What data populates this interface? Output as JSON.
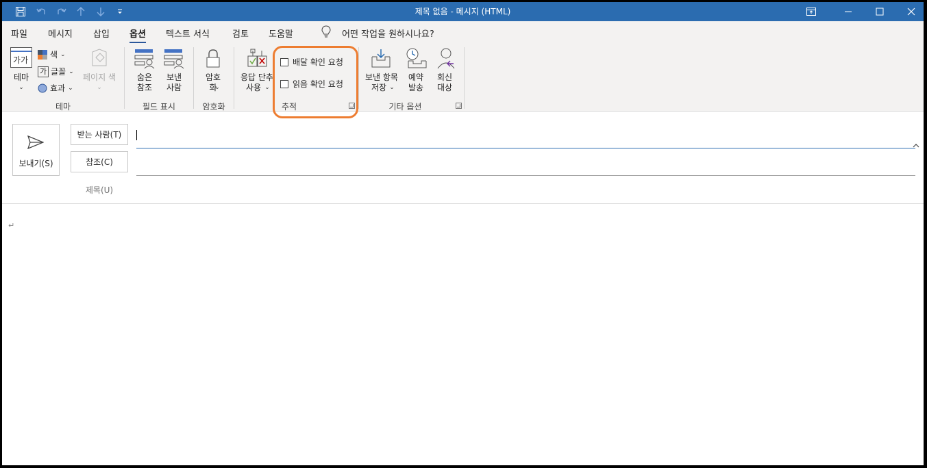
{
  "window": {
    "title": "제목 없음  -  메시지 (HTML)"
  },
  "quick_access": [
    "save-icon",
    "undo-icon",
    "redo-icon",
    "up-arrow-icon",
    "down-arrow-icon",
    "customize-icon"
  ],
  "menu": {
    "tabs": [
      {
        "label": "파일",
        "active": false
      },
      {
        "label": "메시지",
        "active": false
      },
      {
        "label": "삽입",
        "active": false
      },
      {
        "label": "옵션",
        "active": true
      },
      {
        "label": "텍스트 서식",
        "active": false
      },
      {
        "label": "검토",
        "active": false
      },
      {
        "label": "도움말",
        "active": false
      }
    ],
    "tell_me": "어떤 작업을 원하시나요?"
  },
  "ribbon": {
    "theme_group": {
      "label": "테마",
      "theme_button": "테마",
      "theme_icon_text": "가가",
      "colors": "색",
      "fonts": "글꼴",
      "fonts_icon_text": "가",
      "effects": "효과",
      "page_color": "페이지 색"
    },
    "fields_group": {
      "label": "필드 표시",
      "bcc_line1": "숨은",
      "bcc_line2": "참조",
      "from_line1": "보낸",
      "from_line2": "사람"
    },
    "encrypt_group": {
      "label": "암호화",
      "encrypt_line1": "암호",
      "encrypt_line2": "화"
    },
    "tracking_group": {
      "label": "추적",
      "voting_line1": "응답 단추",
      "voting_line2": "사용",
      "delivery_receipt": "배달 확인 요청",
      "read_receipt": "읽음 확인 요청"
    },
    "more_options_group": {
      "label": "기타 옵션",
      "save_sent_line1": "보낸 항목",
      "save_sent_line2": "저장",
      "delay_line1": "예약",
      "delay_line2": "발송",
      "reply_line1": "회신",
      "reply_line2": "대상"
    }
  },
  "compose": {
    "send": "보내기(S)",
    "to": "받는 사람(T)",
    "cc": "참조(C)",
    "subject": "제목(U)",
    "to_value": "",
    "cc_value": "",
    "subject_value": ""
  },
  "colors": {
    "titlebar": "#2b6cb0",
    "highlight": "#ed7d31",
    "active_field_line": "#2b6cb0"
  }
}
